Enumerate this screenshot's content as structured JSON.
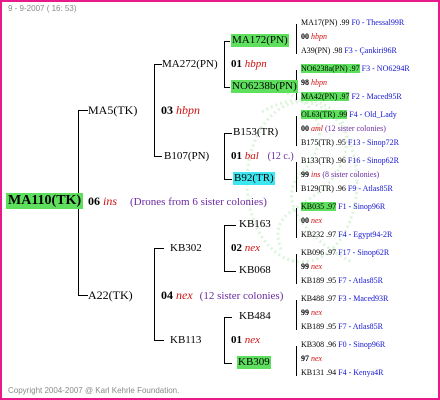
{
  "header": {
    "date": "9 - 9-2007 ( 16: 53)"
  },
  "footer": {
    "copyright": "Copyright 2004-2007 @ Karl Kehrle Foundation."
  },
  "root": {
    "name": "MA110(TK)",
    "year": "06",
    "mark": "ins",
    "note": "(Drones from 6 sister colonies)"
  },
  "gen1": [
    {
      "name": "MA5(TK)",
      "year": "03",
      "mark": "hbpn"
    },
    {
      "name": "A22(TK)",
      "year": "04",
      "mark": "nex",
      "note": "(12 sister colonies)"
    }
  ],
  "gen2": [
    {
      "name": "MA272(PN)",
      "year": "01",
      "mark": "hbpn"
    },
    {
      "name": "B107(PN)",
      "year": "01",
      "mark": "bal",
      "note": "(12 c.)"
    },
    {
      "name": "KB302",
      "year": "02",
      "mark": "nex"
    },
    {
      "name": "KB113",
      "year": "01",
      "mark": "nex"
    }
  ],
  "gen3": [
    {
      "name": "MA172(PN)"
    },
    {
      "name": "NO6238b(PN)"
    },
    {
      "name": "B153(TR)"
    },
    {
      "name": "B92(TR)"
    },
    {
      "name": "KB163"
    },
    {
      "name": "KB068"
    },
    {
      "name": "KB484"
    },
    {
      "name": "KB309"
    }
  ],
  "gen4": [
    {
      "line1": "MA17(PN) .99",
      "loc1": "F0 - Thessal99R",
      "year": "00",
      "mark": "hbpn",
      "line2": "A39(PN) .98",
      "loc2": "F3 - Çankiri96R"
    },
    {
      "line1": "NO6238a(PN) .97",
      "loc1": "F3 - NO6294R",
      "year": "98",
      "mark": "hbpn",
      "line2": "MA42(PN) .97",
      "loc2": "F2 - Maced95R"
    },
    {
      "line1": "OL63(TR) .99",
      "loc1": "F4 - Old_Lady",
      "year": "00",
      "mark": "aml",
      "note": "(12 sister colonies)",
      "line2": "B175(TR) .95",
      "loc2": "F13 - Sinop72R"
    },
    {
      "line1": "B133(TR) .96",
      "loc1": "F16 - Sinop62R",
      "year": "99",
      "mark": "ins",
      "note": "(8 sister colonies)",
      "line2": "B129(TR) .96",
      "loc2": "F9 - Atlas85R"
    },
    {
      "line1": "KB035 .97",
      "loc1": "F1 - Sinop96R",
      "year": "00",
      "mark": "nex",
      "line2": "KB232 .97",
      "loc2": "F4 - Egypt94-2R"
    },
    {
      "line1": "KB096 .97",
      "loc1": "F17 - Sinop62R",
      "year": "99",
      "mark": "nex",
      "line2": "KB189 .95",
      "loc2": "F7 - Atlas85R"
    },
    {
      "line1": "KB488 .97",
      "loc1": "F3 - Maced93R",
      "year": "99",
      "mark": "nex",
      "line2": "KB189 .95",
      "loc2": "F7 - Atlas85R"
    },
    {
      "line1": "KB308 .96",
      "loc1": "F0 - Sinop96R",
      "year": "97",
      "mark": "nex",
      "line2": "KB131 .94",
      "loc2": "F4 - Kenya4R"
    }
  ],
  "colors": {
    "border": "#e8198b",
    "highlight_green": "#5ee05e",
    "highlight_cyan": "#3ee6f0",
    "link_blue": "#1414d2",
    "note_purple": "#6a2aa0",
    "mark_red": "#d01010"
  },
  "icons": {
    "watermark": "bee-watermark-icon"
  }
}
